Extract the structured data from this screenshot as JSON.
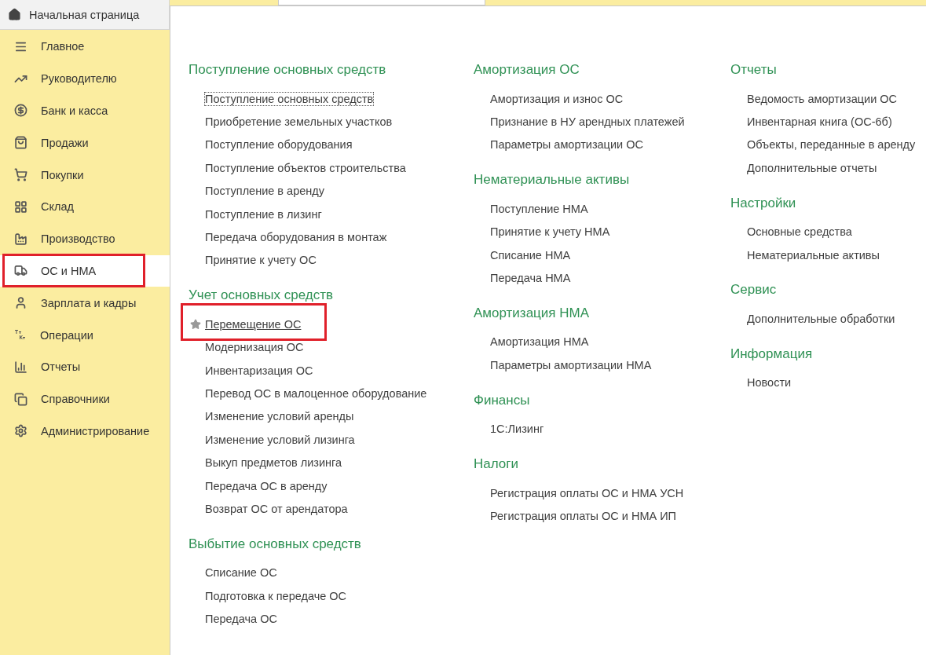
{
  "home_tab": {
    "label": "Начальная страница"
  },
  "sidebar": {
    "items": [
      {
        "label": "Главное",
        "selected": false,
        "highlighted": false
      },
      {
        "label": "Руководителю",
        "selected": false,
        "highlighted": false
      },
      {
        "label": "Банк и касса",
        "selected": false,
        "highlighted": false
      },
      {
        "label": "Продажи",
        "selected": false,
        "highlighted": false
      },
      {
        "label": "Покупки",
        "selected": false,
        "highlighted": false
      },
      {
        "label": "Склад",
        "selected": false,
        "highlighted": false
      },
      {
        "label": "Производство",
        "selected": false,
        "highlighted": false
      },
      {
        "label": "ОС и НМА",
        "selected": true,
        "highlighted": true
      },
      {
        "label": "Зарплата и кадры",
        "selected": false,
        "highlighted": false
      },
      {
        "label": "Операции",
        "selected": false,
        "highlighted": false
      },
      {
        "label": "Отчеты",
        "selected": false,
        "highlighted": false
      },
      {
        "label": "Справочники",
        "selected": false,
        "highlighted": false
      },
      {
        "label": "Администрирование",
        "selected": false,
        "highlighted": false
      }
    ]
  },
  "columns": [
    {
      "sections": [
        {
          "title": "Поступление основных средств",
          "links": [
            {
              "label": "Поступление основных средств",
              "focused": true,
              "favorite": false,
              "highlighted": false
            },
            {
              "label": "Приобретение земельных участков",
              "focused": false,
              "favorite": false,
              "highlighted": false
            },
            {
              "label": "Поступление оборудования",
              "focused": false,
              "favorite": false,
              "highlighted": false
            },
            {
              "label": "Поступление объектов строительства",
              "focused": false,
              "favorite": false,
              "highlighted": false
            },
            {
              "label": "Поступление в аренду",
              "focused": false,
              "favorite": false,
              "highlighted": false
            },
            {
              "label": "Поступление в лизинг",
              "focused": false,
              "favorite": false,
              "highlighted": false
            },
            {
              "label": "Передача оборудования в монтаж",
              "focused": false,
              "favorite": false,
              "highlighted": false
            },
            {
              "label": "Принятие к учету ОС",
              "focused": false,
              "favorite": false,
              "highlighted": false
            }
          ]
        },
        {
          "title": "Учет основных средств",
          "links": [
            {
              "label": "Перемещение ОС",
              "focused": false,
              "favorite": true,
              "highlighted": true
            },
            {
              "label": "Модернизация ОС",
              "focused": false,
              "favorite": false,
              "highlighted": false
            },
            {
              "label": "Инвентаризация ОС",
              "focused": false,
              "favorite": false,
              "highlighted": false
            },
            {
              "label": "Перевод ОС в малоценное оборудование",
              "focused": false,
              "favorite": false,
              "highlighted": false
            },
            {
              "label": "Изменение условий аренды",
              "focused": false,
              "favorite": false,
              "highlighted": false
            },
            {
              "label": "Изменение условий лизинга",
              "focused": false,
              "favorite": false,
              "highlighted": false
            },
            {
              "label": "Выкуп предметов лизинга",
              "focused": false,
              "favorite": false,
              "highlighted": false
            },
            {
              "label": "Передача ОС в аренду",
              "focused": false,
              "favorite": false,
              "highlighted": false
            },
            {
              "label": "Возврат ОС от арендатора",
              "focused": false,
              "favorite": false,
              "highlighted": false
            }
          ]
        },
        {
          "title": "Выбытие основных средств",
          "links": [
            {
              "label": "Списание ОС",
              "focused": false,
              "favorite": false,
              "highlighted": false
            },
            {
              "label": "Подготовка к передаче ОС",
              "focused": false,
              "favorite": false,
              "highlighted": false
            },
            {
              "label": "Передача ОС",
              "focused": false,
              "favorite": false,
              "highlighted": false
            }
          ]
        }
      ]
    },
    {
      "sections": [
        {
          "title": "Амортизация ОС",
          "links": [
            {
              "label": "Амортизация и износ ОС",
              "focused": false,
              "favorite": false,
              "highlighted": false
            },
            {
              "label": "Признание в НУ арендных платежей",
              "focused": false,
              "favorite": false,
              "highlighted": false
            },
            {
              "label": "Параметры амортизации ОС",
              "focused": false,
              "favorite": false,
              "highlighted": false
            }
          ]
        },
        {
          "title": "Нематериальные активы",
          "links": [
            {
              "label": "Поступление НМА",
              "focused": false,
              "favorite": false,
              "highlighted": false
            },
            {
              "label": "Принятие к учету НМА",
              "focused": false,
              "favorite": false,
              "highlighted": false
            },
            {
              "label": "Списание НМА",
              "focused": false,
              "favorite": false,
              "highlighted": false
            },
            {
              "label": "Передача НМА",
              "focused": false,
              "favorite": false,
              "highlighted": false
            }
          ]
        },
        {
          "title": "Амортизация НМА",
          "links": [
            {
              "label": "Амортизация НМА",
              "focused": false,
              "favorite": false,
              "highlighted": false
            },
            {
              "label": "Параметры амортизации НМА",
              "focused": false,
              "favorite": false,
              "highlighted": false
            }
          ]
        },
        {
          "title": "Финансы",
          "links": [
            {
              "label": "1С:Лизинг",
              "focused": false,
              "favorite": false,
              "highlighted": false
            }
          ]
        },
        {
          "title": "Налоги",
          "links": [
            {
              "label": "Регистрация оплаты ОС и НМА УСН",
              "focused": false,
              "favorite": false,
              "highlighted": false
            },
            {
              "label": "Регистрация оплаты ОС и НМА ИП",
              "focused": false,
              "favorite": false,
              "highlighted": false
            }
          ]
        }
      ]
    },
    {
      "sections": [
        {
          "title": "Отчеты",
          "links": [
            {
              "label": "Ведомость амортизации ОС",
              "focused": false,
              "favorite": false,
              "highlighted": false
            },
            {
              "label": "Инвентарная книга (ОС-6б)",
              "focused": false,
              "favorite": false,
              "highlighted": false
            },
            {
              "label": "Объекты, переданные в аренду",
              "focused": false,
              "favorite": false,
              "highlighted": false
            },
            {
              "label": "Дополнительные отчеты",
              "focused": false,
              "favorite": false,
              "highlighted": false
            }
          ]
        },
        {
          "title": "Настройки",
          "links": [
            {
              "label": "Основные средства",
              "focused": false,
              "favorite": false,
              "highlighted": false
            },
            {
              "label": "Нематериальные активы",
              "focused": false,
              "favorite": false,
              "highlighted": false
            }
          ]
        },
        {
          "title": "Сервис",
          "links": [
            {
              "label": "Дополнительные обработки",
              "focused": false,
              "favorite": false,
              "highlighted": false
            }
          ]
        },
        {
          "title": "Информация",
          "links": [
            {
              "label": "Новости",
              "focused": false,
              "favorite": false,
              "highlighted": false
            }
          ]
        }
      ]
    }
  ]
}
